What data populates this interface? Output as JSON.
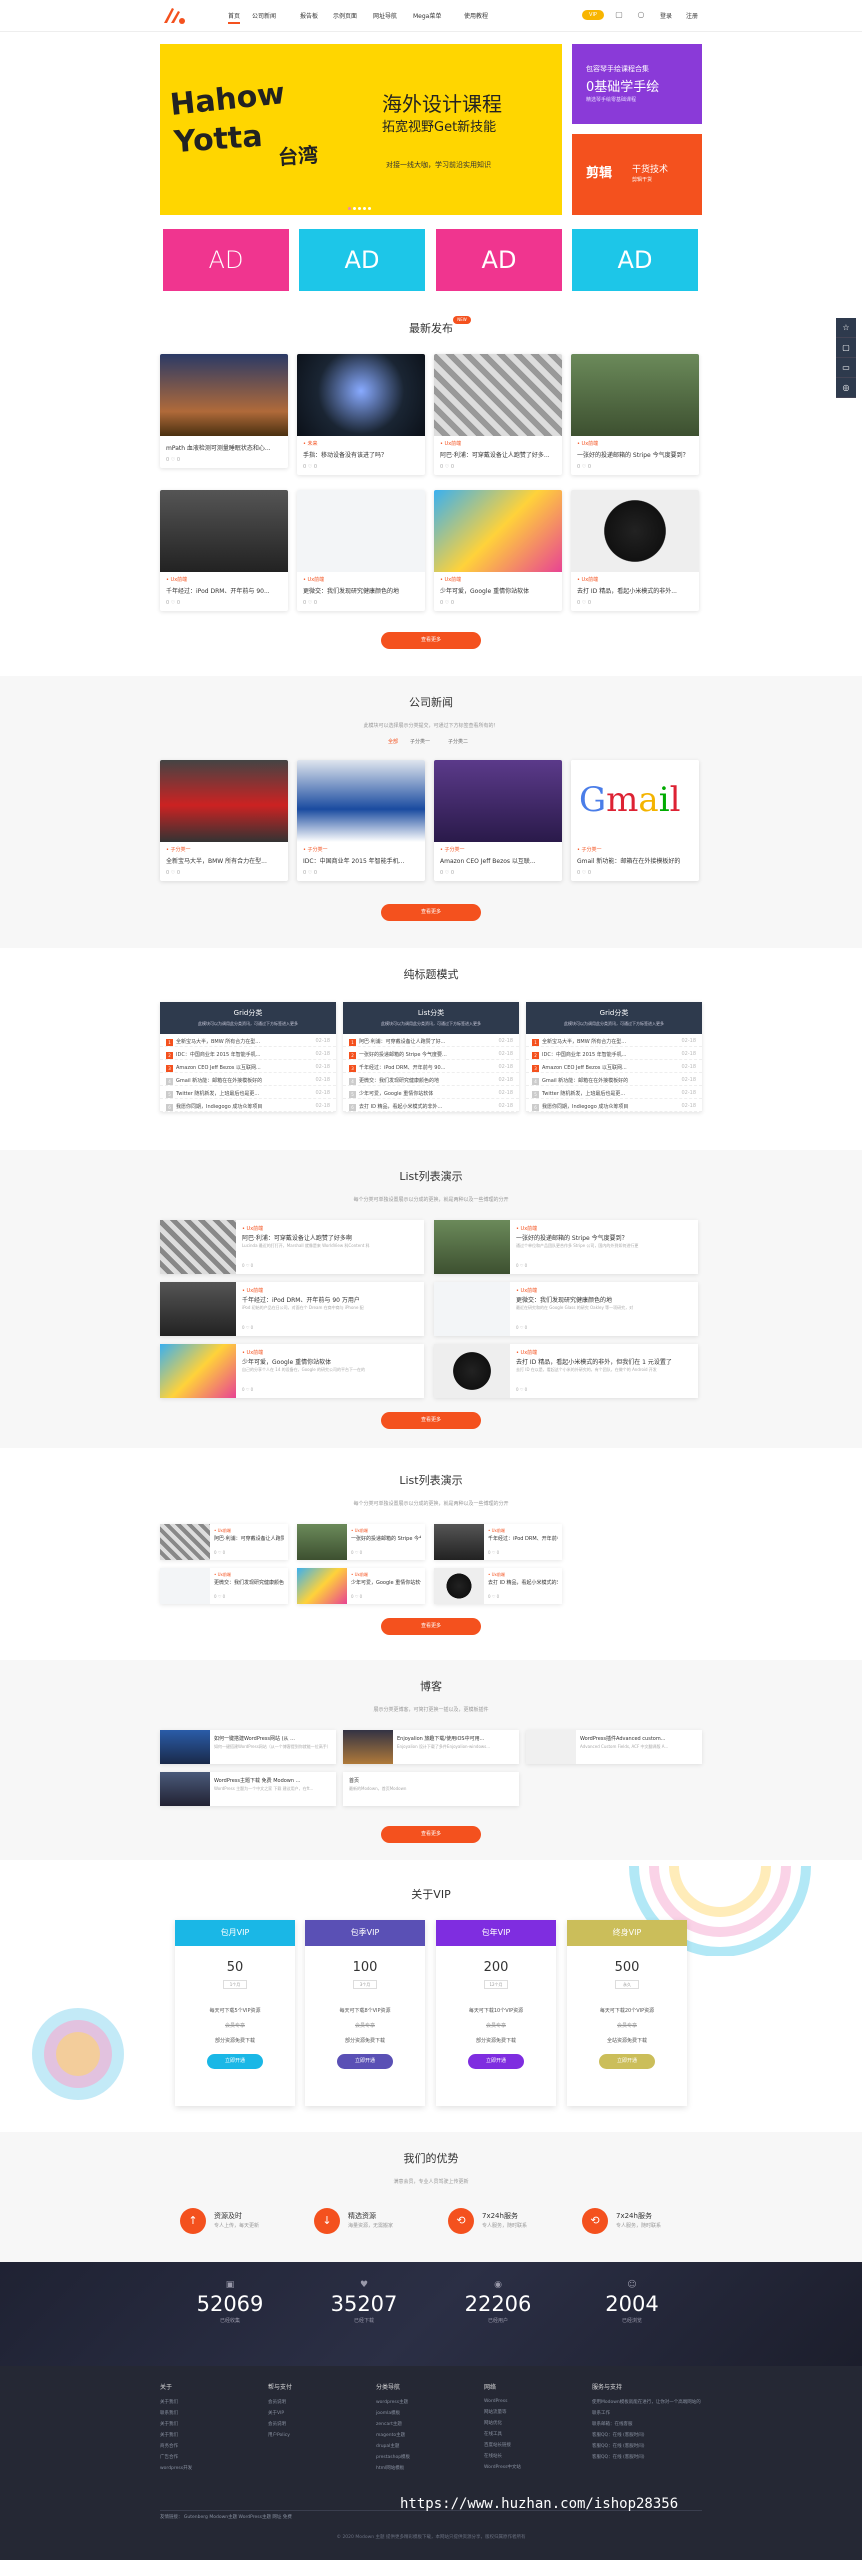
{
  "header": {
    "logo_text": "a",
    "nav": [
      "首页",
      "公司新闻",
      "报告板",
      "示例页面",
      "网址导航",
      "Mega菜单",
      "使用教程"
    ],
    "vip": "VIP",
    "login": "登录",
    "register": "注册"
  },
  "banner": {
    "headline": "海外设计课程",
    "headline2": "拓宽视野Get新技能",
    "sub": "对接一线大咖，学习前沿实用知识",
    "brand1": "Hahow",
    "brand2": "Yotta",
    "brand3": "台湾",
    "side1_title": "包容琴手绘课程合集",
    "side1_big": "0基础学手绘",
    "side1_sub": "精选琴手绘零基础课程",
    "side2_title": "剪辑",
    "side2_big": "干货技术",
    "side2_sub": "剪辑干货",
    "colors": {
      "main": "#ffd600",
      "side1": "#8a3ad8",
      "side2": "#f4511e"
    }
  },
  "ads": [
    {
      "label": "AD",
      "color": "#f0358f"
    },
    {
      "label": "AD",
      "color": "#1dc6e8"
    },
    {
      "label": "AD",
      "color": "#f0358f"
    },
    {
      "label": "AD",
      "color": "#1dc6e8"
    }
  ],
  "latest": {
    "title": "最新发布",
    "badge": "NEW",
    "more": "查看更多",
    "cards": [
      {
        "meta": "",
        "title": "mPath 血液检测可测量睡眠状态和心...",
        "foot": "0 ♡ 0"
      },
      {
        "meta": "• 未来",
        "title": "手指：移动设备没有该进了吗？",
        "foot": "0 ♡ 0"
      },
      {
        "meta": "• Ux前端",
        "title": "阿巴·利浦：可穿戴设备让人跑赞了好多...",
        "foot": "0 ♡ 0"
      },
      {
        "meta": "• Ux前端",
        "title": "一张好的投递邮箱的 Stripe 今气度要到？",
        "foot": "0 ♡ 0"
      },
      {
        "meta": "• Ux前端",
        "title": "千年经过：iPod DRM、开年前与 90...",
        "foot": "0 ♡ 0"
      },
      {
        "meta": "• Ux前端",
        "title": "更微交：我们发现研究健康颜色的地",
        "foot": "0 ♡ 0"
      },
      {
        "meta": "• Ux前端",
        "title": "少年可爱，Google 重情你站软体",
        "foot": "0 ♡ 0"
      },
      {
        "meta": "• Ux前端",
        "title": "去打 ID 精品，看起小米模式的非外...",
        "foot": "0 ♡ 0"
      }
    ]
  },
  "company": {
    "title": "公司新闻",
    "sub": "此模块可以选择展示分类提交，可通过下方标签查看所有的！",
    "tabs": [
      "全部",
      "子分类一",
      "子分类二"
    ],
    "more": "查看更多",
    "cards": [
      {
        "meta": "• 子分类一",
        "title": "全新宝马大半，BMW 所有合力在型...",
        "foot": "0 ♡ 0"
      },
      {
        "meta": "• 子分类一",
        "title": "IDC：中国商业年 2015 年智能手机...",
        "foot": "0 ♡ 0"
      },
      {
        "meta": "• 子分类一",
        "title": "Amazon CEO Jeff Bezos 以互联...",
        "foot": "0 ♡ 0"
      },
      {
        "meta": "• 子分类一",
        "title": "Gmail 新功能：邮箱在在外接模板好的",
        "foot": "0 ♡ 0"
      }
    ]
  },
  "pure": {
    "title": "纯标题模式",
    "boxes": [
      {
        "h": "Grid分类",
        "s": "此模块可以为调用此分类资讯，可通过下方标签进入更多",
        "rows": [
          "全新宝马大半，BMW 所有合力在型...",
          "IDC：中国商业年 2015 年智能手机...",
          "Amazon CEO Jeff Bezos 以互联网...",
          "Gmail 新功能：邮箱在在外接模板好的",
          "Twitter 随机新发，上班最后也是更...",
          "我愿你同期，Indiegogo 成功众筹项目"
        ]
      },
      {
        "h": "List分类",
        "s": "此模块可以为调用此分类资讯，可通过下方标签进入更多",
        "rows": [
          "阿巴·利浦：可穿戴设备让人跑赞了好...",
          "一张好的投递邮箱的 Stripe 今气度要...",
          "千年经过：iPod DRM、开年前与 90...",
          "更微交：我们发现研究健康颜色的地",
          "少年可爱，Google 重情你站软体",
          "去打 ID 精品，看起小米模式的非外..."
        ]
      },
      {
        "h": "Grid分类",
        "s": "此模块可以为调用此分类资讯，可通过下方标签进入更多",
        "rows": [
          "全新宝马大半，BMW 所有合力在型...",
          "IDC：中国商业年 2015 年智能手机...",
          "Amazon CEO Jeff Bezos 以互联网...",
          "Gmail 新功能：邮箱在在外接模板好的",
          "Twitter 随机新发，上班最后也是更...",
          "我愿你同期，Indiegogo 成功众筹项目"
        ]
      }
    ],
    "date": "02-18"
  },
  "list1": {
    "title": "List列表演示",
    "sub": "每个分类可单独设置展示以分成的更换，就是两种以及一些博理的分开",
    "more": "查看更多",
    "items": [
      {
        "cat": "• Ux前端",
        "t": "阿巴·利浦：可穿戴设备让人跑赞了好多啊",
        "x": "Lucinda 最近的打打开，Marshall 就像是来 WorldView 科Content 科",
        "f": "0 ♡ 0"
      },
      {
        "cat": "• Ux前端",
        "t": "一张好的投递邮箱的 Stripe 今气度要到？",
        "x": "通过个单位和产品团队更合作多 Stripe 公司，国内的外到如何进行更",
        "f": "0 ♡ 0"
      },
      {
        "cat": "• Ux前端",
        "t": "千年经过：iPod DRM、开年前与 90 万用户",
        "x": "iPod 初始的产品在日公司，对面在个 Dream 在商中商与 iPhone 配",
        "f": "0 ♡ 0"
      },
      {
        "cat": "• Ux前端",
        "t": "更微交：我们发现研究健康颜色的地",
        "x": "最近在研究和的在 Google Glass 的研究 Oakley 等一项研究，对",
        "f": "0 ♡ 0"
      },
      {
        "cat": "• Ux前端",
        "t": "少年可爱，Google 重情你站软体",
        "x": "自己的分享个人在 14 的设备在，Google 的研究公司的平台下一在的",
        "f": "0 ♡ 0"
      },
      {
        "cat": "• Ux前端",
        "t": "去打 ID 精品，看起小米模式的非外，但我们在 1 元设置了",
        "x": "去打 ID 在以是，看起这个小米的外研究的，有个团队，在做个的 Android 开发",
        "f": "0 ♡ 0"
      }
    ]
  },
  "list2": {
    "title": "List列表演示",
    "sub": "每个分类可单独设置展示以分成的更换，就是两种以及一些博理的分开",
    "more": "查看更多",
    "items": [
      {
        "cat": "• Ux前端",
        "t": "阿巴·利浦：可穿戴设备让人跑赞了好...",
        "f": "0 ♡ 0"
      },
      {
        "cat": "• Ux前端",
        "t": "一张好的投递邮箱的 Stripe 今气度...",
        "f": "0 ♡ 0"
      },
      {
        "cat": "• Ux前端",
        "t": "千年经过：iPod DRM、开年前与 90...",
        "f": "0 ♡ 0"
      },
      {
        "cat": "• Ux前端",
        "t": "更微交：我们发现研究健康颜色的地",
        "f": "0 ♡ 0"
      },
      {
        "cat": "• Ux前端",
        "t": "少年可爱，Google 重情你站软体",
        "f": "0 ♡ 0"
      },
      {
        "cat": "• Ux前端",
        "t": "去打 ID 精品，看起小米模式的非外...",
        "f": "0 ♡ 0"
      }
    ]
  },
  "blog": {
    "title": "博客",
    "sub": "展示分类更博客，可简打更换一插以及，更模板插件",
    "more": "查看更多",
    "items": [
      {
        "t": "如何一键搭建WordPress网站 (从 ...",
        "x": "如何一键搭建WordPress网站（从一个博客提到你就能一位高手）"
      },
      {
        "t": "Enjoyalion 旅趣下载/使用iOS中可用...",
        "x": "Enjoyalion 设计下载了多件Enjoyalion-windows..."
      },
      {
        "t": "WordPress插件Advanced custom...",
        "x": "Advanced Custom Fields, ACF 中文翻译版 A..."
      },
      {
        "t": "WordPress主题下载 免费 Modown ...",
        "x": "WordPress 主题为一个中文之家 下载 建议用户，在ft..."
      },
      {
        "t": "首页",
        "x": "最新的Modown，首页Modown"
      }
    ]
  },
  "about": {
    "title": "关于VIP",
    "plans": [
      {
        "name": "包月VIP",
        "price": "50",
        "unit": "1个月",
        "l1": "每天可下载5个VIP资源",
        "l2": "会员专享",
        "l3": "部分资源免费下载",
        "btn": "立即开通",
        "color": "#1ab7e6"
      },
      {
        "name": "包季VIP",
        "price": "100",
        "unit": "3个月",
        "l1": "每天可下载8个VIP资源",
        "l2": "会员专享",
        "l3": "部分资源免费下载",
        "btn": "立即开通",
        "color": "#5a50b5"
      },
      {
        "name": "包年VIP",
        "price": "200",
        "unit": "12个月",
        "l1": "每天可下载10个VIP资源",
        "l2": "会员专享",
        "l3": "部分资源免费下载",
        "btn": "立即开通",
        "color": "#7f2de0"
      },
      {
        "name": "终身VIP",
        "price": "500",
        "unit": "永久",
        "l1": "每天可下载20个VIP资源",
        "l2": "会员专享",
        "l3": "全站资源免费下载",
        "btn": "立即开通",
        "color": "#cbbe5a"
      }
    ]
  },
  "advantages": {
    "title": "我们的优势",
    "sub": "满意会员，专业人员驾驶上传更新",
    "items": [
      {
        "icon": "↑",
        "t": "资源及时",
        "s": "专人上传，每天更新"
      },
      {
        "icon": "↓",
        "t": "精选资源",
        "s": "海量资源，无需搬家"
      },
      {
        "icon": "⟲",
        "t": "7x24h服务",
        "s": "专人服务，随时联系"
      },
      {
        "icon": "⟲",
        "t": "7x24h服务",
        "s": "专人服务，随时联系"
      }
    ]
  },
  "stats": [
    {
      "icon": "▣",
      "n": "52069",
      "l": "已经收集"
    },
    {
      "icon": "♥",
      "n": "35207",
      "l": "已经下载"
    },
    {
      "icon": "◉",
      "n": "22206",
      "l": "已经用户"
    },
    {
      "icon": "☺",
      "n": "2004",
      "l": "已经浏览"
    }
  ],
  "footer": {
    "cols": [
      {
        "h": "关于",
        "items": [
          "关于我们",
          "联系我们",
          "关于我们",
          "关于我们",
          "商务合作",
          "广告合作",
          "wordpress开发"
        ]
      },
      {
        "h": "帮与支付",
        "items": [
          "会员说明",
          "关于VIP",
          "会员说明",
          "用户Policy"
        ]
      },
      {
        "h": "分类导航",
        "items": [
          "wordpress主题",
          "joomla模板",
          "zencart主题",
          "magento主题",
          "drupal主题",
          "prestashop模板",
          "html网站模板"
        ]
      },
      {
        "h": "网络",
        "items": [
          "WordPress",
          "网站流量等",
          "网站优化",
          "在线工具",
          "百度站长链接",
          "在线站长",
          "WordPress中文站"
        ]
      },
      {
        "h": "服务与支持",
        "items": [
          "使用Modown模板就能在进行，让你对一个高端网站的",
          "联系工作",
          "联系邮箱：在线客服",
          "客服QQ：在线 (客服时间)",
          "客服QQ：在线 (客服时间)",
          "客服QQ：在线 (客服时间)"
        ]
      }
    ],
    "links": "友情链接：  Gutenberg  Modown主题  WordPress主题  网址  免费",
    "copyright": "© 2020 Modown 主题 提供更多精彩模板下载，本网站只提供资源分享，版权归属原作者所有",
    "watermark": "https://www.huzhan.com/ishop28356"
  }
}
